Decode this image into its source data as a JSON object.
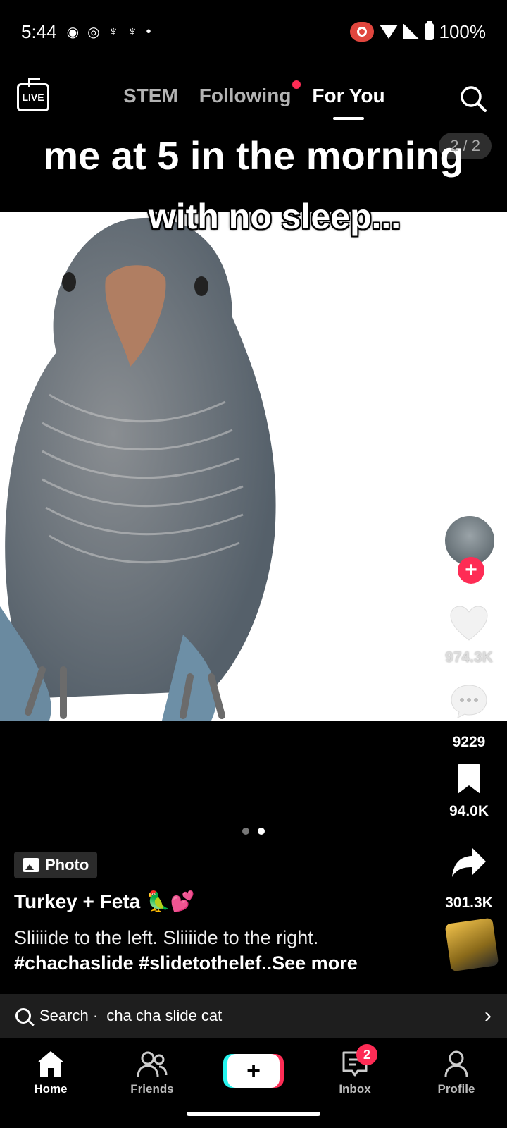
{
  "status_bar": {
    "time": "5:44",
    "battery": "100%"
  },
  "top_nav": {
    "live_label": "LIVE",
    "tabs": [
      {
        "label": "STEM",
        "active": false
      },
      {
        "label": "Following",
        "active": false,
        "has_dot": true
      },
      {
        "label": "For You",
        "active": true
      }
    ]
  },
  "post": {
    "caption_line1": "me at 5 in the morning",
    "caption_line2": "with no sleep...",
    "counter": "2 / 2",
    "type_label": "Photo",
    "username": "Turkey + Feta 🦜💕",
    "description": "Sliiiide to the left. Sliiiide to the right.",
    "hashtags": "#chachaslide #slidetothelef..",
    "see_more": "See more"
  },
  "actions": {
    "likes": "974.3K",
    "comments": "9229",
    "saves": "94.0K",
    "shares": "301.3K"
  },
  "pager": {
    "count": 2,
    "active_index": 1
  },
  "search_suggestion": {
    "prefix": "Search ·",
    "query": "cha cha slide cat"
  },
  "bottom_nav": {
    "items": [
      {
        "label": "Home",
        "icon": "home-icon",
        "active": true
      },
      {
        "label": "Friends",
        "icon": "friends-icon",
        "active": false
      },
      {
        "label": "",
        "icon": "create-plus-icon",
        "active": false
      },
      {
        "label": "Inbox",
        "icon": "inbox-icon",
        "active": false,
        "badge": "2"
      },
      {
        "label": "Profile",
        "icon": "profile-icon",
        "active": false
      }
    ]
  },
  "colors": {
    "accent_red": "#fe2c55",
    "accent_cyan": "#25f4ee",
    "background": "#000000"
  }
}
